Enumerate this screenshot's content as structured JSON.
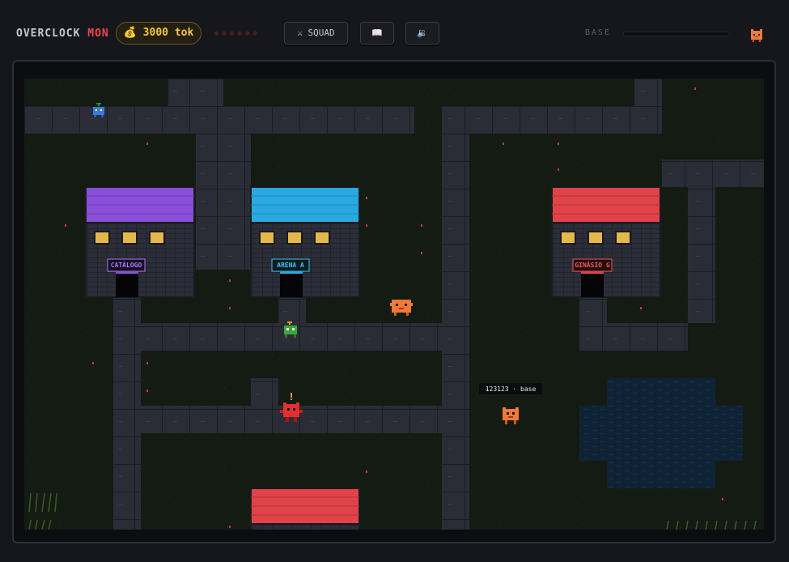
{
  "header": {
    "brand_main": "OVERCLOCK",
    "brand_accent": "MON",
    "tokens": "💰 3000 tok",
    "hearts": "◆◆◆◆◆◆",
    "squad_label": "⚔ SQUAD",
    "book_icon": "📖",
    "sound_icon": "🔉",
    "base_label": "BASE",
    "base_progress": 0
  },
  "map": {
    "buildings": [
      {
        "sign": "CATÁLOGO",
        "roof": "#8a4fd8",
        "sign_color": "#b07aff"
      },
      {
        "sign": "ARENA A",
        "roof": "#2aa8e0",
        "sign_color": "#3ec4f0"
      },
      {
        "sign": "GINÁSIO G",
        "roof": "#e0444a",
        "sign_color": "#f05a5a"
      }
    ],
    "player_tag": "123123 · base",
    "alert": "!"
  },
  "colors": {
    "grass": "#141a12",
    "path": "#2a2d36",
    "water": "#0f2337",
    "accent_red": "#f0464a",
    "gold": "#f5c842"
  }
}
